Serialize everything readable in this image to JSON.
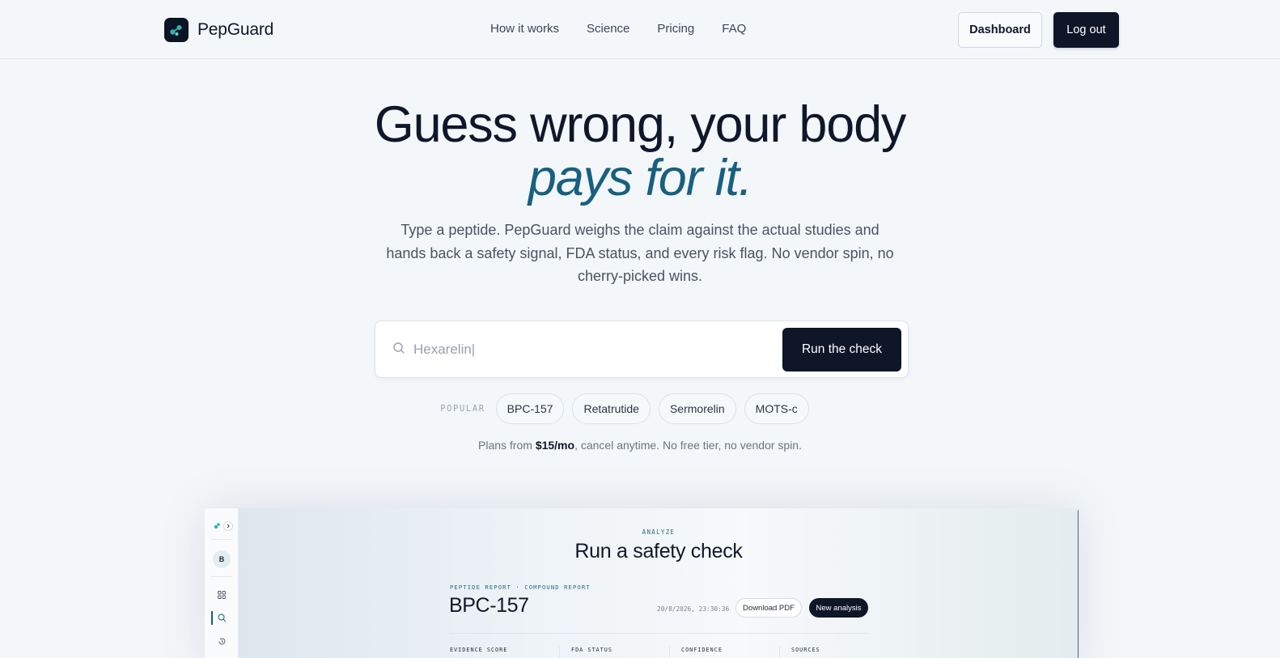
{
  "header": {
    "brand": "PepGuard",
    "nav": [
      "How it works",
      "Science",
      "Pricing",
      "FAQ"
    ],
    "dashboard_label": "Dashboard",
    "logout_label": "Log out"
  },
  "hero": {
    "line1": "Guess wrong, your body",
    "line2": "pays for it.",
    "description": "Type a peptide. PepGuard weighs the claim against the actual studies and hands back a safety signal, FDA status, and every risk flag. No vendor spin, no cherry-picked wins."
  },
  "search": {
    "value": "Hexarelin|",
    "run_label": "Run the check"
  },
  "popular": {
    "label": "POPULAR",
    "chips": [
      "BPC-157",
      "Retatrutide",
      "Sermorelin",
      "MOTS-c"
    ]
  },
  "plans": {
    "prefix": "Plans from ",
    "price": "$15/mo",
    "suffix": ", cancel anytime. No free tier, no vendor spin."
  },
  "preview": {
    "sidebar_avatar": "B",
    "eyebrow": "ANALYZE",
    "title": "Run a safety check",
    "report_label": "PEPTIDE REPORT · COMPOUND REPORT",
    "report_name": "BPC-157",
    "timestamp": "20/8/2026, 23:30:36",
    "download_label": "Download PDF",
    "new_label": "New analysis",
    "stats": [
      "EVIDENCE SCORE",
      "FDA STATUS",
      "CONFIDENCE",
      "SOURCES"
    ]
  },
  "colors": {
    "accent": "#185f80",
    "dark": "#0e1628",
    "background": "#f3f7fa"
  }
}
